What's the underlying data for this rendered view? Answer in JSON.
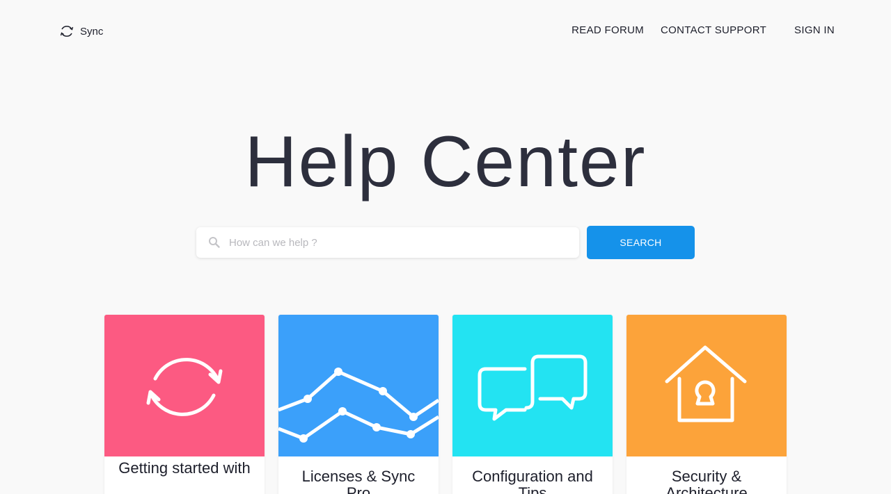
{
  "header": {
    "logo_label": "Sync",
    "nav": {
      "read_forum": "READ FORUM",
      "contact_support": "CONTACT SUPPORT",
      "sign_in": "SIGN IN"
    }
  },
  "hero": {
    "title": "Help Center",
    "search": {
      "placeholder": "How can we help ?",
      "value": "",
      "button_label": "SEARCH"
    }
  },
  "categories": [
    {
      "label": "Getting started with",
      "color": "#fc5a82",
      "icon": "sync-arrows-icon"
    },
    {
      "label": "Licenses & Sync Pro",
      "color": "#3ba0fa",
      "icon": "line-chart-icon"
    },
    {
      "label": "Configuration and Tips",
      "color": "#23e3f2",
      "icon": "chat-bubbles-icon"
    },
    {
      "label": "Security & Architecture",
      "color": "#fca33a",
      "icon": "house-lock-icon"
    }
  ],
  "colors": {
    "accent": "#1592ea",
    "text_dark": "#2d2f3d",
    "background": "#f9f9f9"
  }
}
